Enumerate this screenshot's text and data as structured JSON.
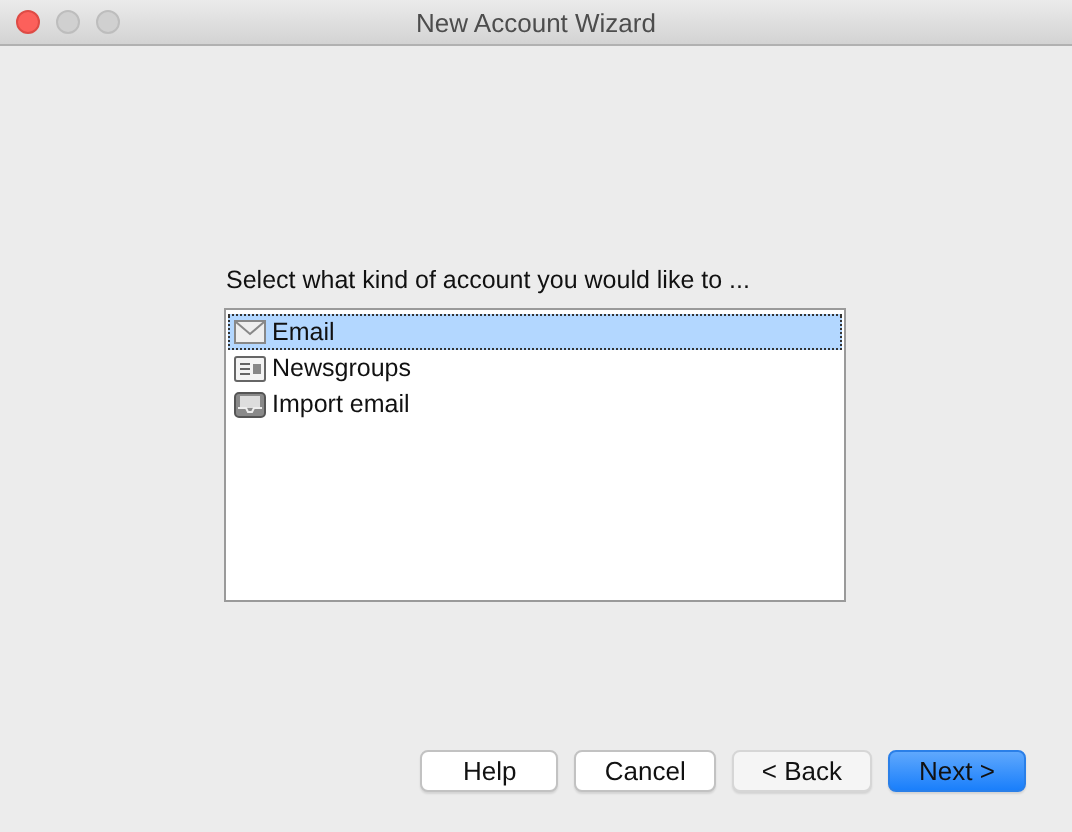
{
  "window": {
    "title": "New Account Wizard"
  },
  "prompt": "Select what kind of account you would like to ...",
  "account_types": [
    {
      "label": "Email",
      "kind": "envelope",
      "selected": true
    },
    {
      "label": "Newsgroups",
      "kind": "newspaper",
      "selected": false
    },
    {
      "label": "Import email",
      "kind": "tray",
      "selected": false
    }
  ],
  "buttons": [
    {
      "label": "Help",
      "default": false,
      "disabled": false
    },
    {
      "label": "Cancel",
      "default": false,
      "disabled": false
    },
    {
      "label": "< Back",
      "default": false,
      "disabled": true
    },
    {
      "label": "Next >",
      "default": true,
      "disabled": false
    }
  ]
}
